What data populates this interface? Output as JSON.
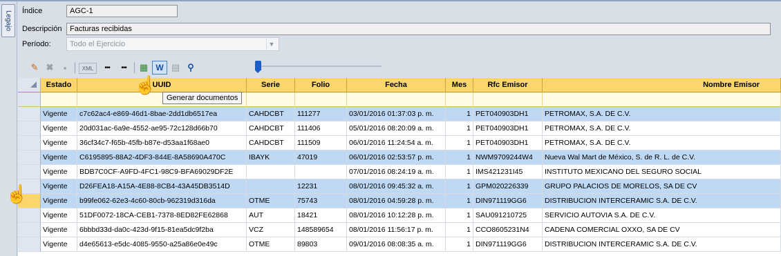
{
  "side_tab": "Legajo",
  "form": {
    "indice_label": "Índice",
    "indice_value": "AGC-1",
    "descripcion_label": "Descripción",
    "descripcion_value": "Facturas recibidas",
    "periodo_label": "Período:",
    "periodo_value": "Todo el Ejercicio"
  },
  "toolbar": {
    "items": [
      "pencil-icon",
      "delete-icon",
      "save-icon",
      "xml-icon",
      "dots-icon",
      "dots2-icon",
      "grid-icon",
      "word-icon",
      "clipboard-icon",
      "search-icon"
    ],
    "xml_label": "XML",
    "word_label": "W",
    "dots1": "•••",
    "dots2": "•••"
  },
  "tooltip": "Generar documentos",
  "slider": {
    "value": 0.0
  },
  "columns": [
    "Estado",
    "UUID",
    "Serie",
    "Folio",
    "Fecha",
    "Mes",
    "Rfc Emisor",
    "Nombre Emisor"
  ],
  "rows": [
    {
      "estado": "Vigente",
      "uuid": "c7c62ac4-e869-46d1-8bae-2dd1db6517ea",
      "serie": "CAHDCBT",
      "folio": "111277",
      "fecha": "03/01/2016 01:37:03 p. m.",
      "mes": "1",
      "rfc": "PET040903DH1",
      "nombre": "PETROMAX, S.A. DE C.V.",
      "selected": true
    },
    {
      "estado": "Vigente",
      "uuid": "20d031ac-6a9e-4552-ae95-72c128d66b70",
      "serie": "CAHDCBT",
      "folio": "111406",
      "fecha": "05/01/2016 08:20:09 a. m.",
      "mes": "1",
      "rfc": "PET040903DH1",
      "nombre": "PETROMAX, S.A. DE C.V.",
      "selected": false
    },
    {
      "estado": "Vigente",
      "uuid": "36cf34c7-f65b-45fb-b87e-d53aa1f68ae0",
      "serie": "CAHDCBT",
      "folio": "111509",
      "fecha": "06/01/2016 11:24:54 a. m.",
      "mes": "1",
      "rfc": "PET040903DH1",
      "nombre": "PETROMAX, S.A. DE C.V.",
      "selected": false
    },
    {
      "estado": "Vigente",
      "uuid": "C6195895-88A2-4DF3-844E-8A58690A470C",
      "serie": "IBAYK",
      "folio": "47019",
      "fecha": "06/01/2016 02:53:57 p. m.",
      "mes": "1",
      "rfc": "NWM9709244W4",
      "nombre": "Nueva Wal Mart de México, S. de R. L. de C.V.",
      "selected": true
    },
    {
      "estado": "Vigente",
      "uuid": "BDB7C0CF-A9FD-4FC1-98C9-BFA69029DF2E",
      "serie": "",
      "folio": "",
      "fecha": "07/01/2016 08:24:19 a. m.",
      "mes": "1",
      "rfc": "IMS421231I45",
      "nombre": "INSTITUTO MEXICANO DEL SEGURO SOCIAL",
      "selected": false
    },
    {
      "estado": "Vigente",
      "uuid": "D26FEA18-A15A-4E88-8CB4-43A45DB3514D",
      "serie": "",
      "folio": "12231",
      "fecha": "08/01/2016 09:45:32 a. m.",
      "mes": "1",
      "rfc": "GPM020226339",
      "nombre": "GRUPO PALACIOS DE MORELOS, SA DE CV",
      "selected": true
    },
    {
      "estado": "Vigente",
      "uuid": "b99fe062-62e3-4c60-80cb-962319d316da",
      "serie": "OTME",
      "folio": "75743",
      "fecha": "08/01/2016 04:59:28 p. m.",
      "mes": "1",
      "rfc": "DIN971119GG6",
      "nombre": "DISTRIBUCION INTERCERAMIC S.A. DE C.V.",
      "selected": true
    },
    {
      "estado": "Vigente",
      "uuid": "51DF0072-18CA-CEB1-7378-8ED82FE62868",
      "serie": "AUT",
      "folio": "18421",
      "fecha": "08/01/2016 10:12:28 p. m.",
      "mes": "1",
      "rfc": "SAU091210725",
      "nombre": "SERVICIO AUTOVIA S.A. DE C.V.",
      "selected": false
    },
    {
      "estado": "Vigente",
      "uuid": "6bbbd33d-da0c-423d-9f15-81ea5dc9f2ba",
      "serie": "VCZ",
      "folio": "148589654",
      "fecha": "08/01/2016 11:56:17 p. m.",
      "mes": "1",
      "rfc": "CCO8605231N4",
      "nombre": "CADENA COMERCIAL OXXO, SA DE CV",
      "selected": false
    },
    {
      "estado": "Vigente",
      "uuid": "d4e65613-e5dc-4085-9550-a25a86e0e49c",
      "serie": "OTME",
      "folio": "89803",
      "fecha": "09/01/2016 08:08:35 a. m.",
      "mes": "1",
      "rfc": "DIN971119GG6",
      "nombre": "DISTRIBUCION INTERCERAMIC S.A. DE C.V.",
      "selected": false
    }
  ]
}
